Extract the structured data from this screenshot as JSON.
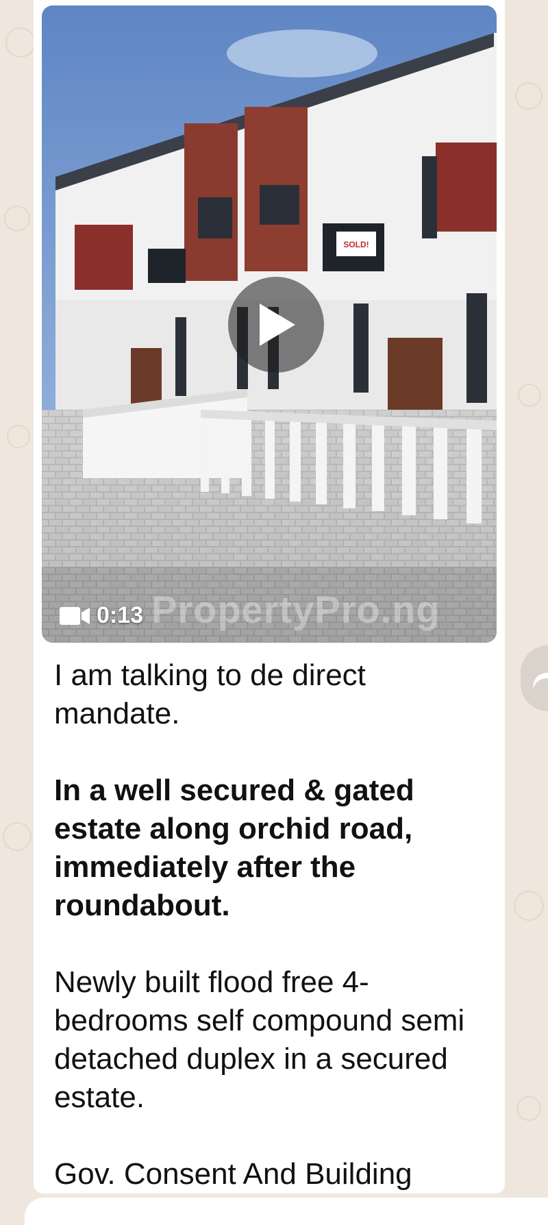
{
  "video": {
    "duration": "0:13",
    "watermark": "PropertyPro.ng",
    "sign_text": "SOLD!"
  },
  "caption": {
    "line1": "I am talking to de direct mandate.",
    "bold_para": "In a well secured & gated estate along orchid road, immediately after the roundabout.",
    "para2": "Newly built flood free 4-bedrooms self compound semi detached duplex in a secured estate.",
    "para3": "Gov. Consent And Building"
  },
  "icons": {
    "play": "play-icon",
    "video_camera": "video-camera-icon",
    "forward": "forward-icon"
  },
  "colors": {
    "wallpaper": "#efe7de",
    "bubble": "#ffffff",
    "text": "#111111"
  }
}
